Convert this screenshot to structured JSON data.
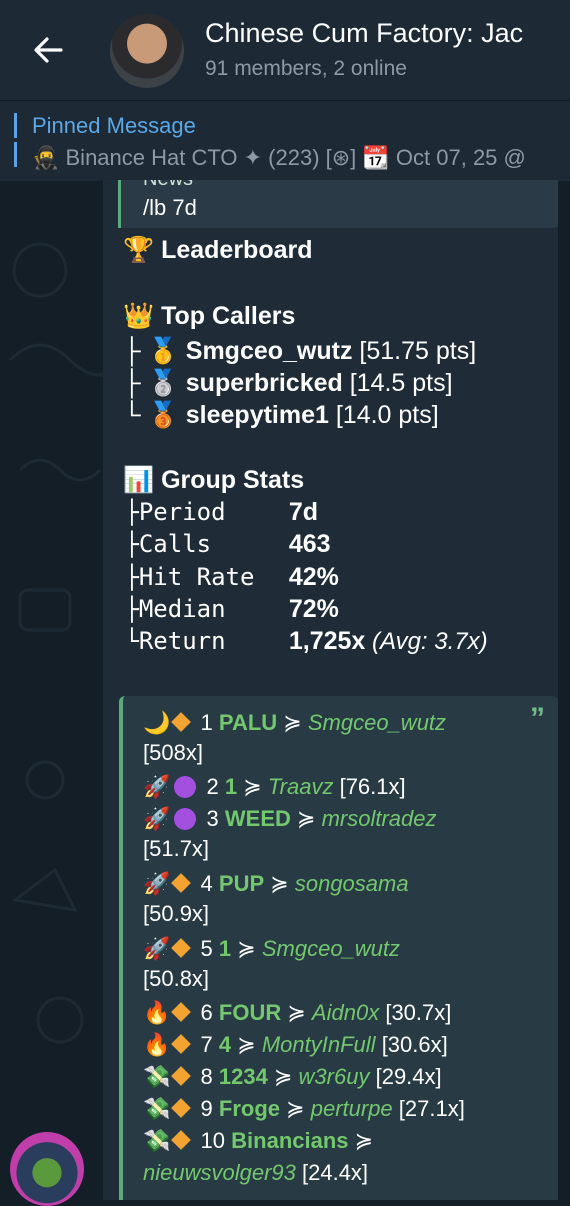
{
  "header": {
    "title": "Chinese Cum Factory: Jac",
    "subtitle": "91 members, 2 online"
  },
  "pinned": {
    "label": "Pinned Message",
    "text": "🥷 Binance Hat CTO ✦ (223) [⊛] 📆 Oct 07, 25 @"
  },
  "message": {
    "news_cut": "News",
    "command": "/lb 7d",
    "leaderboard_title": "🏆 Leaderboard",
    "top_callers_title": "👑 Top Callers",
    "top_callers": [
      {
        "prefix": "├",
        "medal": "🥇",
        "name": "Smgceo_wutz",
        "pts": " [51.75 pts]"
      },
      {
        "prefix": "├",
        "medal": "🥈",
        "name": "superbricked",
        "pts": " [14.5 pts]"
      },
      {
        "prefix": "└",
        "medal": "🥉",
        "name": "sleepytime1",
        "pts": " [14.0 pts]"
      }
    ],
    "group_stats_title": "📊 Group Stats",
    "group_stats": [
      {
        "prefix": "├",
        "key": "Period",
        "value": "7d",
        "extra": ""
      },
      {
        "prefix": "├",
        "key": "Calls",
        "value": "463",
        "extra": ""
      },
      {
        "prefix": "├",
        "key": "Hit Rate",
        "value": "42%",
        "extra": ""
      },
      {
        "prefix": "├",
        "key": "Median",
        "value": "72%",
        "extra": ""
      },
      {
        "prefix": "└",
        "key": "Return",
        "value": "1,725x",
        "extra": " (Avg: 3.7x)"
      }
    ]
  },
  "calls": {
    "quote_icon": "”",
    "items": [
      {
        "emoji": "🌙",
        "marker": "diamond",
        "rank": "1",
        "token": "PALU",
        "sep": "≽",
        "user": "Smgceo_wutz",
        "mult": "[508x]"
      },
      {
        "emoji": "🚀",
        "marker": "purple",
        "rank": "2",
        "token": "1",
        "sep": "≽",
        "user": "Traavz",
        "mult": "[76.1x]"
      },
      {
        "emoji": "🚀",
        "marker": "purple",
        "rank": "3",
        "token": "WEED",
        "sep": "≽",
        "user": "mrsoltradez",
        "mult": "[51.7x]"
      },
      {
        "emoji": "🚀",
        "marker": "diamond",
        "rank": "4",
        "token": "PUP",
        "sep": "≽",
        "user": "songosama",
        "mult": "[50.9x]"
      },
      {
        "emoji": "🚀",
        "marker": "diamond",
        "rank": "5",
        "token": "1",
        "sep": "≽",
        "user": "Smgceo_wutz",
        "mult": "[50.8x]"
      },
      {
        "emoji": "🔥",
        "marker": "diamond",
        "rank": "6",
        "token": "FOUR",
        "sep": "≽",
        "user": "Aidn0x",
        "mult": "[30.7x]"
      },
      {
        "emoji": "🔥",
        "marker": "diamond",
        "rank": "7",
        "token": "4",
        "sep": "≽",
        "user": "MontyInFull",
        "mult": "[30.6x]"
      },
      {
        "emoji": "💸",
        "marker": "diamond",
        "rank": "8",
        "token": "1234",
        "sep": "≽",
        "user": "w3r6uy",
        "mult": "[29.4x]"
      },
      {
        "emoji": "💸",
        "marker": "diamond",
        "rank": "9",
        "token": "Froge",
        "sep": "≽",
        "user": "perturpe",
        "mult": "[27.1x]"
      },
      {
        "emoji": "💸",
        "marker": "diamond",
        "rank": "10",
        "token": "Binancians",
        "sep": "≽",
        "user": "nieuwsvolger93",
        "mult": "[24.4x]"
      }
    ]
  },
  "colors": {
    "background": "#141e27",
    "header": "#1d2a35",
    "accent_blue": "#5ba8e8",
    "accent_green": "#73c86e"
  }
}
